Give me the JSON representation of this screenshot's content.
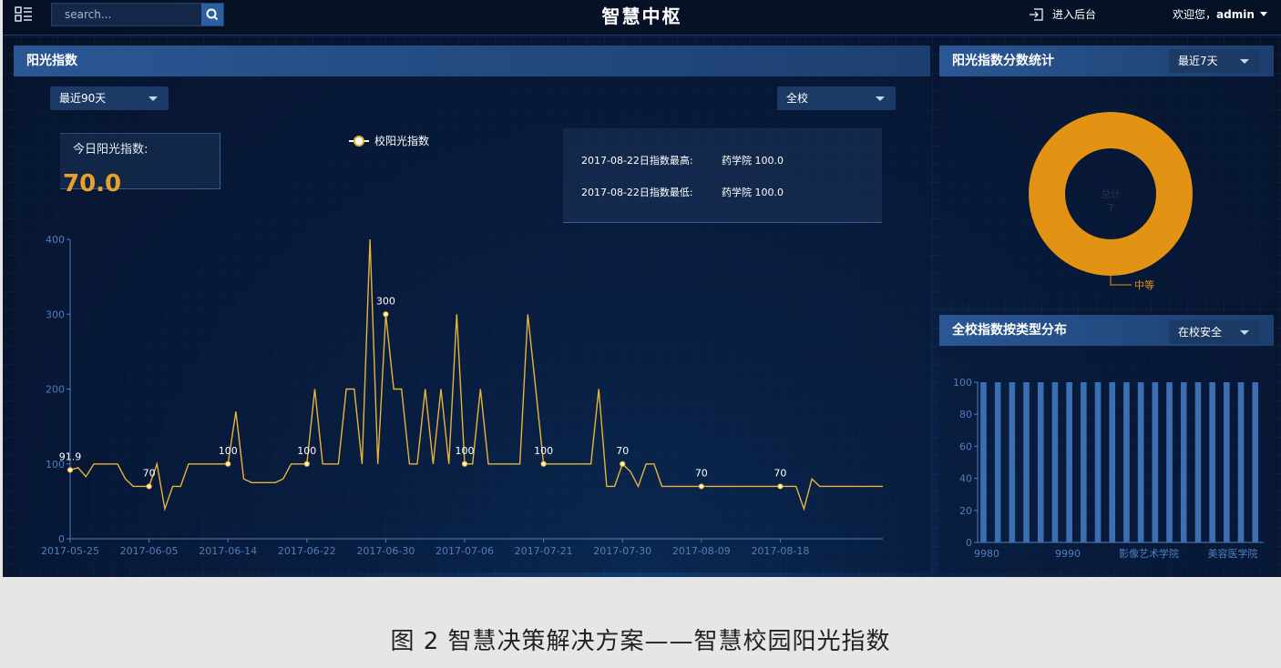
{
  "header": {
    "title": "智慧中枢",
    "search_placeholder": "search...",
    "backend_label": "进入后台",
    "welcome": "欢迎您，",
    "user": "admin"
  },
  "main_panel": {
    "title": "阳光指数",
    "period_select": "最近90天",
    "scope_select": "全校",
    "today_label": "今日阳光指数:",
    "today_value": "70.0",
    "legend": "校阳光指数",
    "info_rows": [
      {
        "label": "2017-08-22日指数最高:",
        "value": "药学院 100.0"
      },
      {
        "label": "2017-08-22日指数最低:",
        "value": "药学院 100.0"
      }
    ]
  },
  "donut_panel": {
    "title": "阳光指数分数统计",
    "select": "最近7天",
    "center_label": "总计",
    "center_value": "7",
    "slice_label": "中等"
  },
  "bar_panel": {
    "title": "全校指数按类型分布",
    "select": "在校安全"
  },
  "caption": "图 2  智慧决策解决方案——智慧校园阳光指数",
  "colors": {
    "line": "#e8b33a",
    "donut": "#e39314",
    "bar": "#3c6fb0",
    "accent": "#e8a12a"
  },
  "chart_data": [
    {
      "type": "line",
      "series_name": "校阳光指数",
      "ylim": [
        0,
        400
      ],
      "yticks": [
        0,
        100,
        200,
        300,
        400
      ],
      "xtick_labels": [
        "2017-05-25",
        "2017-06-05",
        "2017-06-14",
        "2017-06-22",
        "2017-06-30",
        "2017-07-06",
        "2017-07-21",
        "2017-07-30",
        "2017-08-09",
        "2017-08-18"
      ],
      "values": [
        91.9,
        95,
        83,
        100,
        100,
        100,
        100,
        80,
        70,
        70,
        70,
        100,
        40,
        70,
        70,
        100,
        100,
        100,
        100,
        100,
        100,
        170,
        80,
        75,
        75,
        75,
        75,
        80,
        100,
        100,
        100,
        200,
        100,
        100,
        100,
        200,
        200,
        100,
        400,
        100,
        300,
        200,
        200,
        100,
        100,
        200,
        100,
        200,
        100,
        300,
        100,
        100,
        200,
        100,
        100,
        100,
        100,
        100,
        300,
        200,
        100,
        100,
        100,
        100,
        100,
        100,
        100,
        200,
        70,
        70,
        100,
        90,
        70,
        100,
        100,
        70,
        70,
        70,
        70,
        70,
        70,
        70,
        70,
        70,
        70,
        70,
        70,
        70,
        70,
        70,
        70,
        70,
        70,
        40,
        80,
        70,
        70,
        70,
        70,
        70,
        70,
        70,
        70,
        70
      ],
      "data_labels": [
        {
          "index": 0,
          "text": "91.9"
        },
        {
          "index": 10,
          "text": "70"
        },
        {
          "index": 20,
          "text": "100"
        },
        {
          "index": 30,
          "text": "100"
        },
        {
          "index": 40,
          "text": "300"
        },
        {
          "index": 50,
          "text": "100"
        },
        {
          "index": 60,
          "text": "100"
        },
        {
          "index": 70,
          "text": "70"
        },
        {
          "index": 80,
          "text": "70"
        },
        {
          "index": 90,
          "text": "70"
        }
      ],
      "grid": true
    },
    {
      "type": "pie",
      "slices": [
        {
          "label": "中等",
          "value": 7
        }
      ],
      "total_label": "总计",
      "total": 7
    },
    {
      "type": "bar",
      "ylim": [
        0,
        100
      ],
      "yticks": [
        0,
        20,
        40,
        60,
        80,
        100
      ],
      "xtick_labels": [
        "9980",
        "9990",
        "影像艺术学院",
        "美容医学院"
      ],
      "values": [
        100,
        100,
        100,
        100,
        100,
        100,
        100,
        100,
        100,
        100,
        100,
        100,
        100,
        100,
        100,
        100,
        100,
        100,
        100,
        100
      ]
    }
  ]
}
